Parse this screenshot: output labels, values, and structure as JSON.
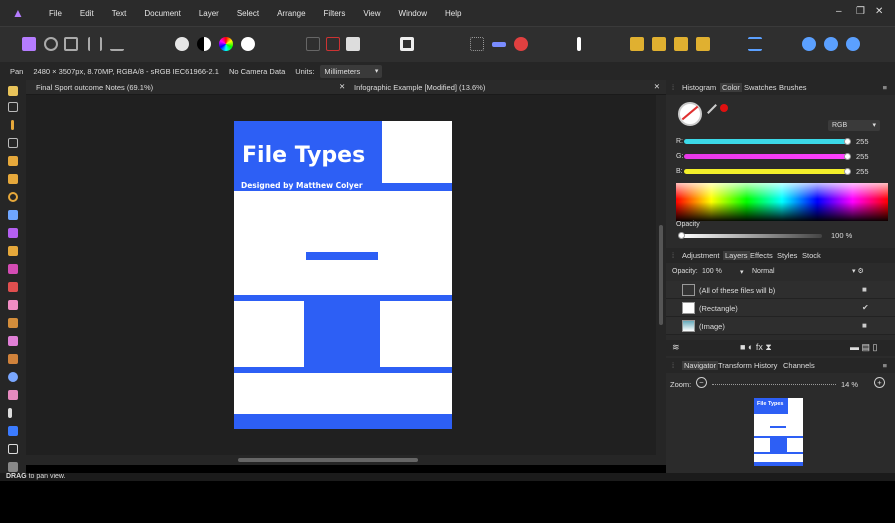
{
  "app": {
    "logo_glyph": "▲",
    "accent": "#b57cff"
  },
  "menu": [
    "File",
    "Edit",
    "Text",
    "Document",
    "Layer",
    "Select",
    "Arrange",
    "Filters",
    "View",
    "Window",
    "Help"
  ],
  "window_controls": {
    "minimize": "–",
    "restore": "❐",
    "close": "✕"
  },
  "context_bar": {
    "tool": "Pan",
    "doc_info": "2480 × 3507px, 8.70MP, RGBA/8 - sRGB IEC61966-2.1",
    "camera": "No Camera Data",
    "units_label": "Units:",
    "units_value": "Millimeters"
  },
  "doc_tabs": {
    "tab1": "Final Sport outcome Notes (69.1%)",
    "tab2": "Infographic Example [Modified] (13.6%)",
    "close_glyph": "✕"
  },
  "document": {
    "title": "File Types",
    "subtitle": "Designed by Matthew Colyer",
    "accent_color": "#2d5ff5"
  },
  "panel_top": {
    "tabs": [
      "Histogram",
      "Color",
      "Swatches",
      "Brushes"
    ],
    "active_tab": "Color",
    "mode": "RGB",
    "channels": [
      {
        "label": "R:",
        "value": "255"
      },
      {
        "label": "G:",
        "value": "255"
      },
      {
        "label": "B:",
        "value": "255"
      }
    ],
    "opacity_label": "Opacity",
    "opacity_value": "100 %"
  },
  "panel_layers": {
    "tabs": [
      "Adjustment",
      "Layers",
      "Effects",
      "Styles",
      "Stock"
    ],
    "active_tab": "Layers",
    "opacity_label": "Opacity:",
    "opacity_value": "100 %",
    "blend_mode": "Normal",
    "layers": [
      {
        "name": "(All of these files will b)",
        "check": "■"
      },
      {
        "name": "(Rectangle)",
        "check": "✔"
      },
      {
        "name": "(Image)",
        "check": "■"
      }
    ]
  },
  "panel_nav": {
    "tabs": [
      "Navigator",
      "Transform",
      "History",
      "Channels"
    ],
    "active_tab": "Navigator",
    "zoom_label": "Zoom:",
    "zoom_value": "14 %",
    "preview_title": "File Types"
  },
  "status": {
    "bold": "DRAG",
    "text": " to pan view."
  }
}
